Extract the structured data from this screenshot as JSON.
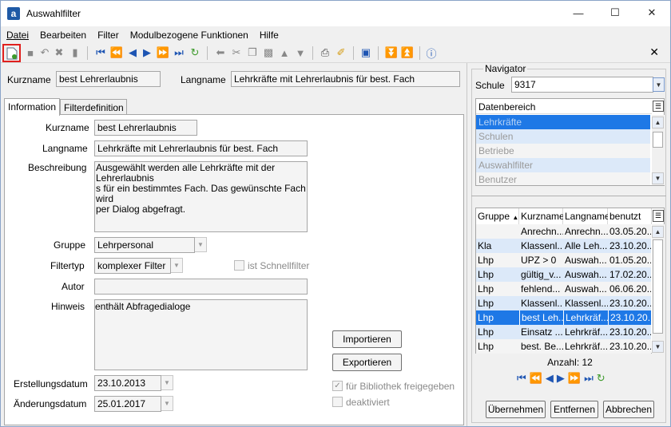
{
  "window": {
    "title": "Auswahlfilter",
    "app_icon": "a"
  },
  "menu": [
    "Datei",
    "Bearbeiten",
    "Filter",
    "Modulbezogene Funktionen",
    "Hilfe"
  ],
  "header": {
    "kurzname_label": "Kurzname",
    "kurzname_value": "best Lehrerlaubnis",
    "langname_label": "Langname",
    "langname_value": "Lehrkräfte mit Lehrerlaubnis für best. Fach"
  },
  "tabs": [
    "Information",
    "Filterdefinition"
  ],
  "form": {
    "kurzname_label": "Kurzname",
    "kurzname": "best Lehrerlaubnis",
    "langname_label": "Langname",
    "langname": "Lehrkräfte mit Lehrerlaubnis für best. Fach",
    "beschreibung_label": "Beschreibung",
    "beschreibung_l1": "Ausgewählt werden alle Lehrkräfte mit der Lehrerlaubnis",
    "beschreibung_l2": "s  für ein bestimmtes Fach. Das gewünschte Fach wird",
    "beschreibung_l3": "per Dialog abgefragt.",
    "gruppe_label": "Gruppe",
    "gruppe": "Lehrpersonal",
    "filtertyp_label": "Filtertyp",
    "filtertyp": "komplexer Filter",
    "schnellfilter_label": "ist Schnellfilter",
    "autor_label": "Autor",
    "autor": "",
    "hinweis_label": "Hinweis",
    "hinweis": "enthält Abfragedialoge",
    "importieren": "Importieren",
    "exportieren": "Exportieren",
    "erstellungsdatum_label": "Erstellungsdatum",
    "erstellungsdatum": "23.10.2013",
    "aenderungsdatum_label": "Änderungsdatum",
    "aenderungsdatum": "25.01.2017",
    "bibliothek_label": "für Bibliothek freigegeben",
    "deaktiviert_label": "deaktiviert"
  },
  "navigator": {
    "title": "Navigator",
    "schule_label": "Schule",
    "schule": "9317",
    "datenbereich_label": "Datenbereich",
    "datenbereich": [
      "Lehrkräfte",
      "Schulen",
      "Betriebe",
      "Auswahlfilter",
      "Benutzer"
    ],
    "columns": [
      "Gruppe",
      "Kurzname",
      "Langname",
      "benutzt"
    ],
    "rows": [
      [
        "",
        "Anrechn...",
        "Anrechn...",
        "03.05.20..."
      ],
      [
        "Kla",
        "Klassenl...",
        "Alle Leh...",
        "23.10.20..."
      ],
      [
        "Lhp",
        "UPZ > 0",
        "Auswah...",
        "01.05.20..."
      ],
      [
        "Lhp",
        "gültig_v...",
        "Auswah...",
        "17.02.20..."
      ],
      [
        "Lhp",
        "fehlend...",
        "Auswah...",
        "06.06.20..."
      ],
      [
        "Lhp",
        "Klassenl...",
        "Klassenl...",
        "23.10.20..."
      ],
      [
        "Lhp",
        "best Leh...",
        "Lehrkräf...",
        "23.10.20..."
      ],
      [
        "Lhp",
        "Einsatz ...",
        "Lehrkräf...",
        "23.10.20..."
      ],
      [
        "Lhp",
        "best. Be...",
        "Lehrkräf...",
        "23.10.20..."
      ]
    ],
    "anzahl": "Anzahl: 12",
    "uebernehmen": "Übernehmen",
    "entfernen": "Entfernen",
    "abbrechen": "Abbrechen"
  },
  "colors": {
    "selection": "#1e78e6",
    "alt_row": "#dce9f9",
    "highlight_border": "#e0201e"
  }
}
